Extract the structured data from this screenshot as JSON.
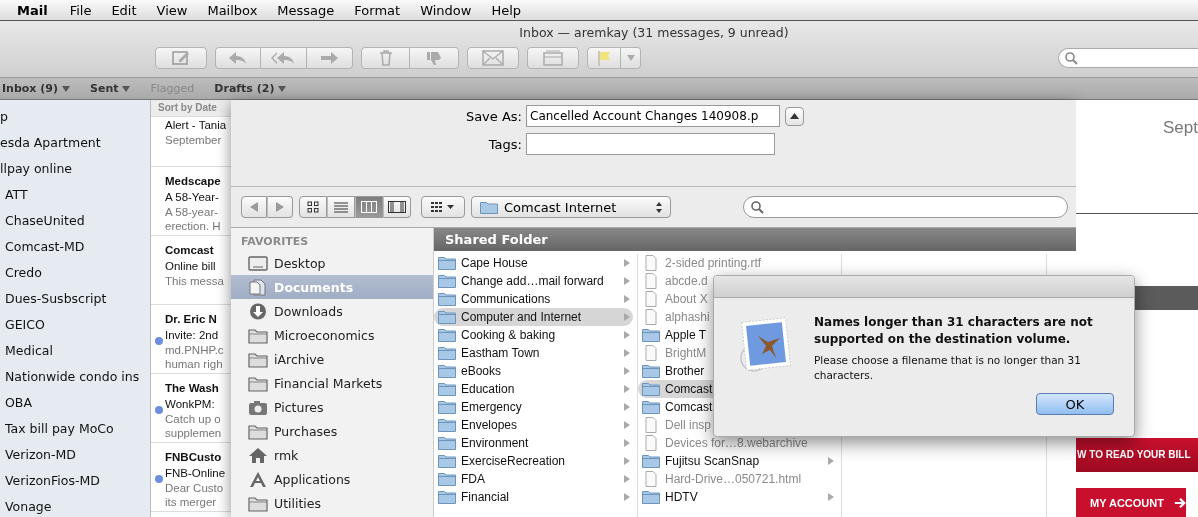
{
  "menu_bar": {
    "app": "Mail",
    "items": [
      "File",
      "Edit",
      "View",
      "Mailbox",
      "Message",
      "Format",
      "Window",
      "Help"
    ]
  },
  "window": {
    "title": "Inbox — aremkay (31 messages, 9 unread)"
  },
  "favorites_bar": [
    {
      "label": "Inbox (9)",
      "disabled": false,
      "menu": true
    },
    {
      "label": "Sent",
      "disabled": false,
      "menu": true
    },
    {
      "label": "Flagged",
      "disabled": true,
      "menu": false
    },
    {
      "label": "Drafts (2)",
      "disabled": false,
      "menu": true
    }
  ],
  "mailboxes": [
    {
      "label": "p"
    },
    {
      "label": "esda Apartment"
    },
    {
      "label": "llpay online",
      "children": [
        {
          "label": "ATT"
        },
        {
          "label": "ChaseUnited"
        },
        {
          "label": "Comcast-MD"
        },
        {
          "label": "Credo"
        },
        {
          "label": "Dues-Susbscript"
        },
        {
          "label": "GEICO"
        },
        {
          "label": "Medical"
        },
        {
          "label": "Nationwide condo ins"
        },
        {
          "label": "OBA"
        },
        {
          "label": "Tax bill pay MoCo"
        },
        {
          "label": "Verizon-MD"
        },
        {
          "label": "VerizonFios-MD"
        },
        {
          "label": "Vonage"
        }
      ]
    }
  ],
  "messages": {
    "sort_label": "Sort by Date",
    "items": [
      {
        "subject": "Alert - Tania",
        "preview": [
          "September"
        ],
        "unread": false
      },
      {
        "sender": "Medscape",
        "subject": "A 58-Year-",
        "preview": [
          "A 58-year-",
          "erection. H"
        ],
        "unread": false
      },
      {
        "sender": "Comcast",
        "subject": "Online bill",
        "preview": [
          "This messa"
        ],
        "unread": false
      },
      {
        "sender": "Dr. Eric N",
        "subject": "Invite: 2nd",
        "preview": [
          "md.PNHP.c",
          "human righ"
        ],
        "unread": true
      },
      {
        "sender": "The Wash",
        "subject": "WonkPM:",
        "preview": [
          "Catch up o",
          "supplemen"
        ],
        "unread": true
      },
      {
        "sender": "FNBCusto",
        "subject": "FNB-Online",
        "preview": [
          "Dear Custo",
          "its merger"
        ],
        "unread": true
      }
    ]
  },
  "save_sheet": {
    "save_as_label": "Save As:",
    "save_as_value": "Cancelled Account Changes 140908.p",
    "tags_label": "Tags:",
    "path": "Comcast Internet",
    "view_modes": [
      {
        "kind": "icons",
        "selected": false
      },
      {
        "kind": "list",
        "selected": false
      },
      {
        "kind": "columns",
        "selected": true
      },
      {
        "kind": "coverflow",
        "selected": false
      }
    ],
    "favorites_heading": "FAVORITES",
    "favorites": [
      {
        "label": "Desktop",
        "kind": "desktop",
        "selected": false
      },
      {
        "label": "Documents",
        "kind": "documents",
        "selected": true
      },
      {
        "label": "Downloads",
        "kind": "downloads",
        "selected": false
      },
      {
        "label": "Microeconomics",
        "kind": "folder",
        "selected": false
      },
      {
        "label": "iArchive",
        "kind": "folder",
        "selected": false
      },
      {
        "label": "Financial Markets",
        "kind": "folder",
        "selected": false
      },
      {
        "label": "Pictures",
        "kind": "pictures",
        "selected": false
      },
      {
        "label": "Purchases",
        "kind": "folder",
        "selected": false
      },
      {
        "label": "rmk",
        "kind": "home",
        "selected": false
      },
      {
        "label": "Applications",
        "kind": "applications",
        "selected": false
      },
      {
        "label": "Utilities",
        "kind": "folder",
        "selected": false
      }
    ],
    "column_header": "Shared Folder",
    "columns": [
      [
        {
          "label": "Cape House",
          "kind": "folder",
          "selected": false,
          "has_children": true
        },
        {
          "label": "Change add…mail forward",
          "kind": "folder",
          "selected": false,
          "has_children": true
        },
        {
          "label": "Communications",
          "kind": "folder",
          "selected": false,
          "has_children": true
        },
        {
          "label": "Computer and Internet",
          "kind": "folder",
          "selected": true,
          "has_children": true
        },
        {
          "label": "Cooking & baking",
          "kind": "folder",
          "selected": false,
          "has_children": true
        },
        {
          "label": "Eastham Town",
          "kind": "folder",
          "selected": false,
          "has_children": true
        },
        {
          "label": "eBooks",
          "kind": "folder",
          "selected": false,
          "has_children": true
        },
        {
          "label": "Education",
          "kind": "folder",
          "selected": false,
          "has_children": true
        },
        {
          "label": "Emergency",
          "kind": "folder",
          "selected": false,
          "has_children": true
        },
        {
          "label": "Envelopes",
          "kind": "folder",
          "selected": false,
          "has_children": true
        },
        {
          "label": "Environment",
          "kind": "folder",
          "selected": false,
          "has_children": true
        },
        {
          "label": "ExerciseRecreation",
          "kind": "folder",
          "selected": false,
          "has_children": true
        },
        {
          "label": "FDA",
          "kind": "folder",
          "selected": false,
          "has_children": true
        },
        {
          "label": "Financial",
          "kind": "folder",
          "selected": false,
          "has_children": true
        }
      ],
      [
        {
          "label": "2-sided printing.rtf",
          "kind": "file",
          "selected": false,
          "has_children": false
        },
        {
          "label": "abcde.d",
          "kind": "file",
          "selected": false,
          "has_children": false
        },
        {
          "label": "About X",
          "kind": "file",
          "selected": false,
          "has_children": false
        },
        {
          "label": "alphashi",
          "kind": "file",
          "selected": false,
          "has_children": false
        },
        {
          "label": "Apple T",
          "kind": "folder",
          "selected": false,
          "has_children": false
        },
        {
          "label": "BrightM",
          "kind": "file",
          "selected": false,
          "has_children": false
        },
        {
          "label": "Brother",
          "kind": "folder",
          "selected": false,
          "has_children": false
        },
        {
          "label": "Comcast",
          "kind": "folder",
          "selected": true,
          "has_children": false
        },
        {
          "label": "Comcast",
          "kind": "folder",
          "selected": false,
          "has_children": false
        },
        {
          "label": "Dell insp",
          "kind": "file",
          "selected": false,
          "has_children": false
        },
        {
          "label": "Devices for…8.webarchive",
          "kind": "file",
          "selected": false,
          "has_children": false
        },
        {
          "label": "Fujitsu ScanSnap",
          "kind": "folder",
          "selected": false,
          "has_children": true
        },
        {
          "label": "Hard-Drive…050721.html",
          "kind": "file",
          "selected": false,
          "has_children": false
        },
        {
          "label": "HDTV",
          "kind": "folder",
          "selected": false,
          "has_children": true
        }
      ],
      [],
      []
    ]
  },
  "preview": {
    "date_fragment": "Sept",
    "banner": "W TO READ YOUR BILL",
    "account_button": "MY ACCOUNT"
  },
  "alert": {
    "title": "Names longer than 31 characters are not supported on the destination volume.",
    "message": "Please choose a filename that is no longer than 31 characters.",
    "button": "OK"
  }
}
